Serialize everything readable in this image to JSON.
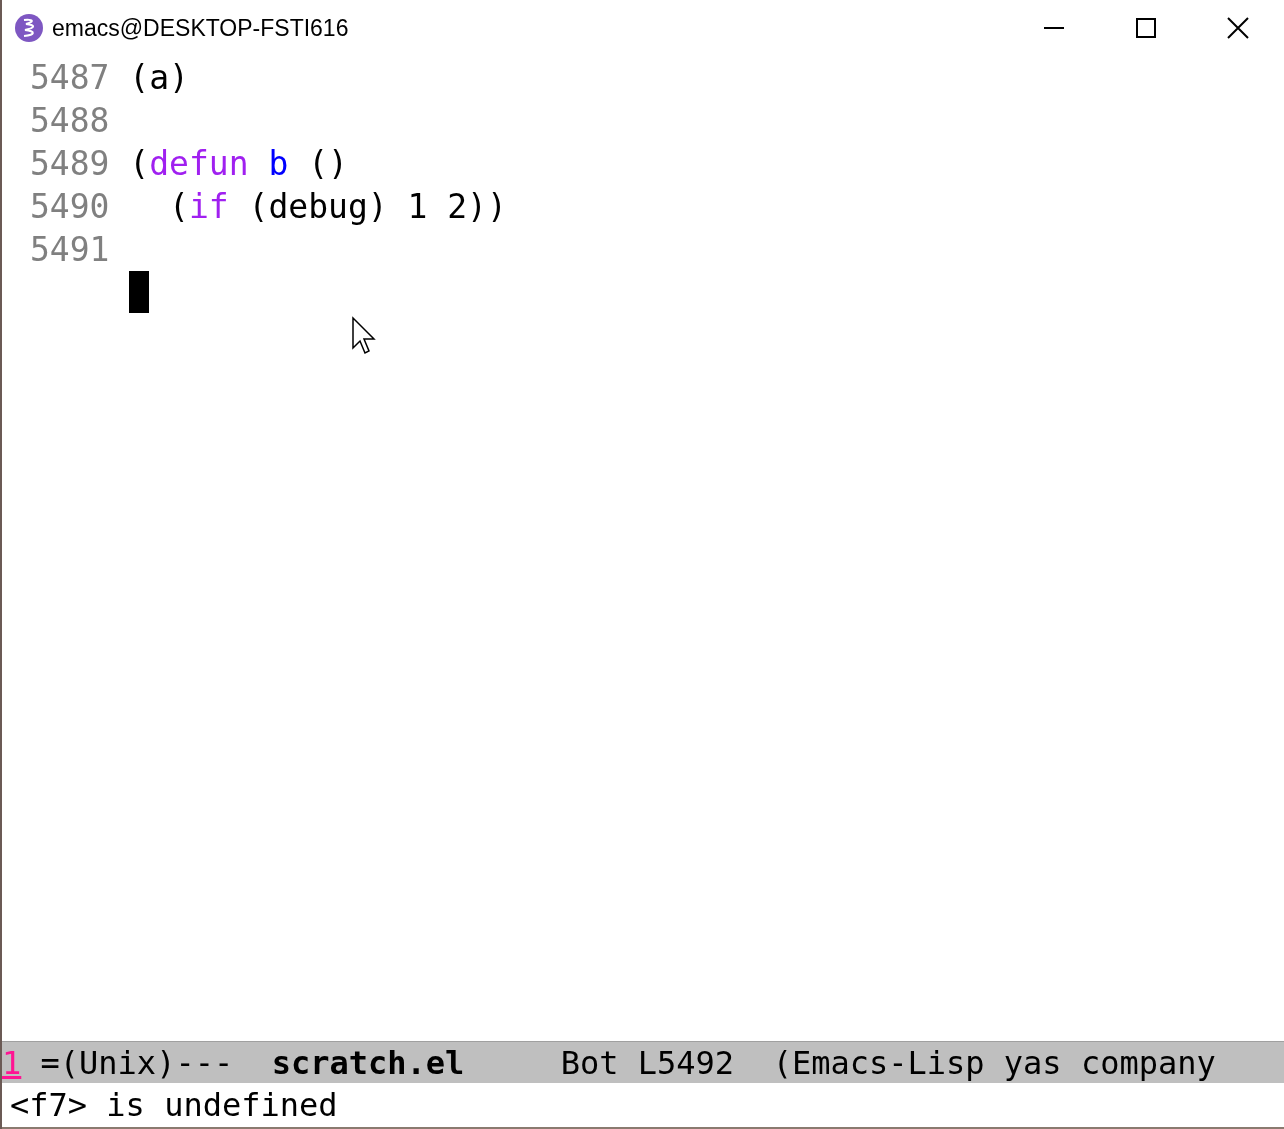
{
  "window": {
    "title": "emacs@DESKTOP-FSTI616"
  },
  "lines": [
    {
      "number": "5487",
      "tokens": [
        {
          "kind": "plain",
          "text": "(a)"
        }
      ]
    },
    {
      "number": "5488"
    },
    {
      "number": "5489",
      "tokens": [
        {
          "kind": "plain",
          "text": "("
        },
        {
          "kind": "keyword",
          "text": "defun"
        },
        {
          "kind": "function-name",
          "text": " b"
        },
        {
          "kind": "plain",
          "text": " ()"
        }
      ]
    },
    {
      "number": "5490",
      "tokens": [
        {
          "kind": "plain",
          "text": "  ("
        },
        {
          "kind": "keyword",
          "text": "if"
        },
        {
          "kind": "plain",
          "text": " (debug) 1 2))"
        }
      ]
    },
    {
      "number": "5491"
    },
    {
      "cursor": true
    }
  ],
  "mode_line": [
    {
      "kind": "window-number",
      "text": "1"
    },
    {
      "kind": "plain",
      "text": "=(Unix)---"
    },
    {
      "kind": "buffer-name",
      "text": "scratch.el"
    },
    {
      "kind": "plain",
      "text": "Bot L5492"
    },
    {
      "kind": "plain",
      "text": "(Emacs-Lisp yas company"
    }
  ],
  "echo_area": {
    "message": "<f7> is undefined"
  }
}
